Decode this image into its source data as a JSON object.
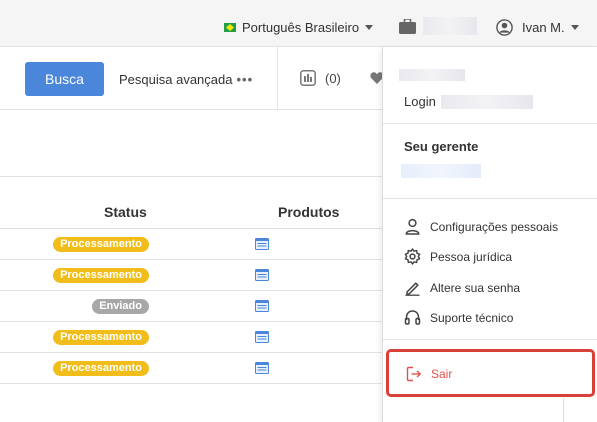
{
  "header": {
    "language": "Português Brasileiro",
    "user_name": "Ivan M."
  },
  "toolbar": {
    "search_label": "Busca",
    "advanced_label": "Pesquisa avançada",
    "advanced_dots": "•••",
    "compare_count": "(0)"
  },
  "table": {
    "columns": [
      "Status",
      "Produtos"
    ],
    "rows": [
      {
        "status": "Processamento",
        "kind": "processing"
      },
      {
        "status": "Processamento",
        "kind": "processing"
      },
      {
        "status": "Enviado",
        "kind": "sent"
      },
      {
        "status": "Processamento",
        "kind": "processing"
      },
      {
        "status": "Processamento",
        "kind": "processing"
      }
    ]
  },
  "dropdown": {
    "login_label": "Login",
    "manager_heading": "Seu gerente",
    "items": [
      {
        "label": "Configurações pessoais",
        "icon": "person-icon"
      },
      {
        "label": "Pessoa jurídica",
        "icon": "gear-icon"
      },
      {
        "label": "Altere sua senha",
        "icon": "pencil-icon"
      },
      {
        "label": "Suporte técnico",
        "icon": "headset-icon"
      }
    ],
    "logout_label": "Sair"
  },
  "colors": {
    "primary": "#4a86d9",
    "processing": "#f0bd1b",
    "sent": "#a7a7a7",
    "highlight": "#d9403a",
    "logout": "#e0534c"
  }
}
